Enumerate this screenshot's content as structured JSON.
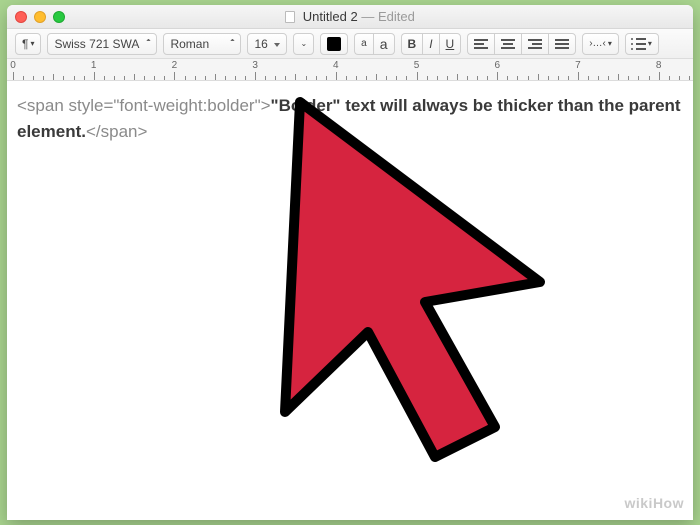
{
  "window": {
    "title": "Untitled 2",
    "status": "Edited"
  },
  "toolbar": {
    "paragraph_style_tip": "¶",
    "font_family": "Swiss 721 SWA",
    "font_style": "Roman",
    "font_size": "16",
    "buttons": {
      "text_small": "a",
      "text_big": "a",
      "bold": "B",
      "italic": "I",
      "underline": "U",
      "spacing_tip": "›…‹"
    }
  },
  "ruler": {
    "labels": [
      "0",
      "1",
      "2",
      "3",
      "4",
      "5",
      "6",
      "7",
      "8"
    ]
  },
  "document": {
    "open_tag": "<span style=\"font-weight:bolder\">",
    "bold_lead": "\"Bolder\" text will always be thicker than the parent",
    "bold_tail": "element.",
    "close_tag": "</span>"
  },
  "watermark": "wikiHow"
}
